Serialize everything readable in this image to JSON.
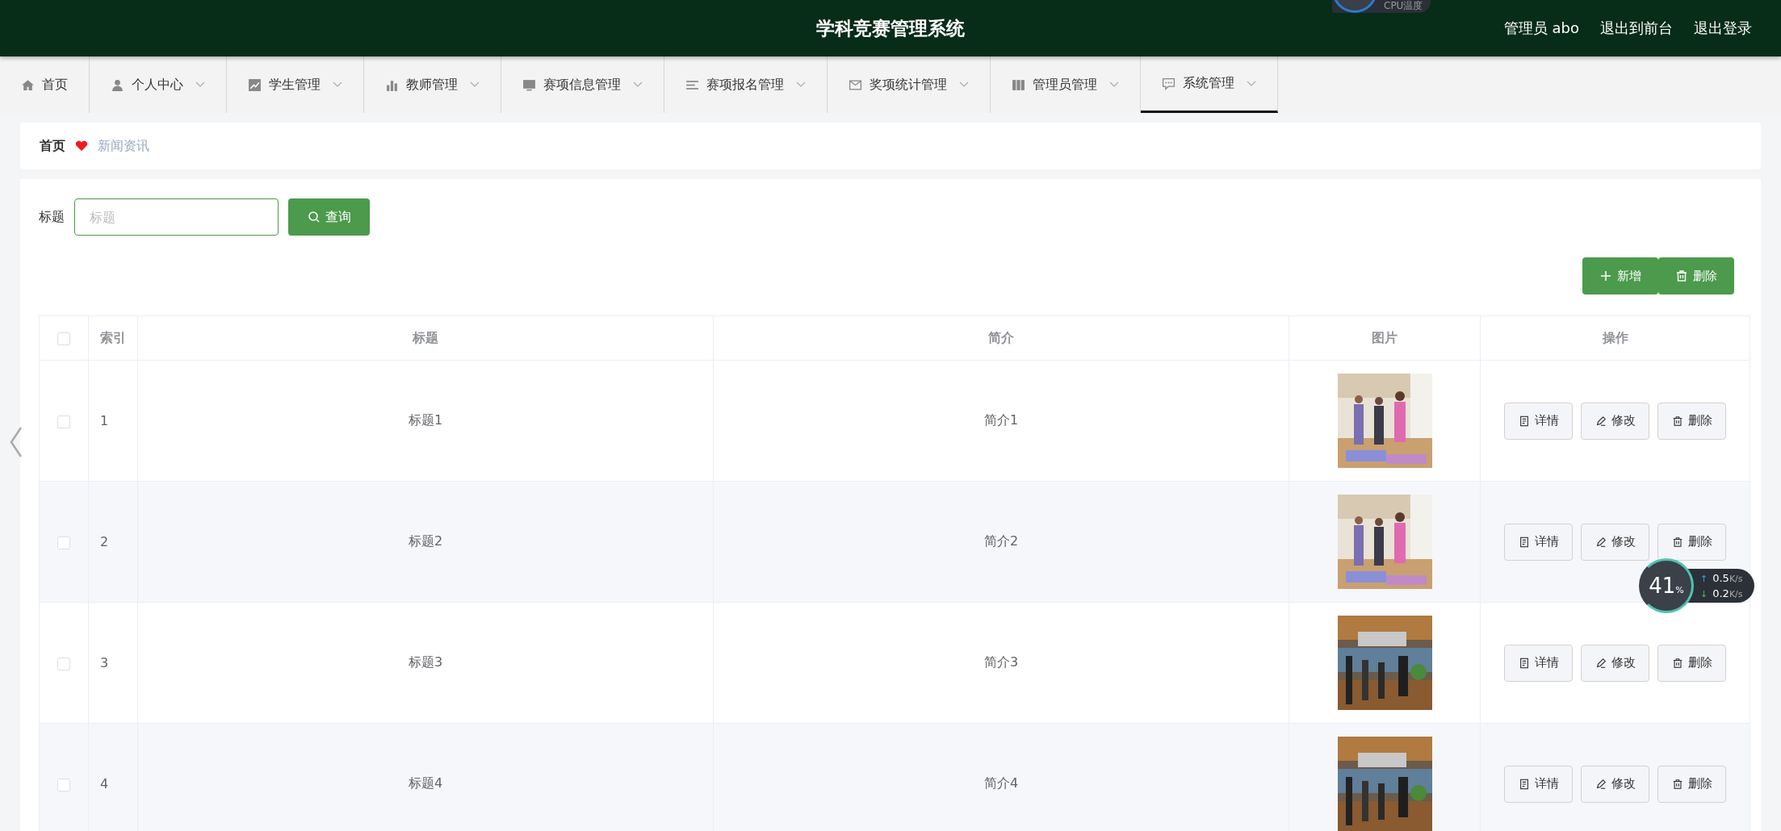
{
  "header": {
    "title": "学科竞赛管理系统",
    "user": "管理员 abo",
    "links": [
      "退出到前台",
      "退出登录"
    ]
  },
  "nav": [
    {
      "label": "首页",
      "dropdown": false,
      "selected": false
    },
    {
      "label": "个人中心",
      "dropdown": true,
      "selected": false
    },
    {
      "label": "学生管理",
      "dropdown": true,
      "selected": false
    },
    {
      "label": "教师管理",
      "dropdown": true,
      "selected": false
    },
    {
      "label": "赛项信息管理",
      "dropdown": true,
      "selected": false
    },
    {
      "label": "赛项报名管理",
      "dropdown": true,
      "selected": false
    },
    {
      "label": "奖项统计管理",
      "dropdown": true,
      "selected": false
    },
    {
      "label": "管理员管理",
      "dropdown": true,
      "selected": false
    },
    {
      "label": "系统管理",
      "dropdown": true,
      "selected": true
    }
  ],
  "breadcrumb": {
    "home": "首页",
    "current": "新闻资讯"
  },
  "search": {
    "label": "标题",
    "placeholder": "标题",
    "button": "查询"
  },
  "actions": [
    "新增",
    "删除"
  ],
  "table": {
    "select_all_checked": false,
    "columns": [
      "索引",
      "标题",
      "简介",
      "图片",
      "操作"
    ],
    "rows": [
      {
        "checked": false,
        "index": "1",
        "title": "标题1",
        "intro": "简介1",
        "picture": {
          "kind": "picture"
        },
        "actions": [
          "详情",
          "修改",
          "删除"
        ]
      },
      {
        "checked": false,
        "index": "2",
        "title": "标题2",
        "intro": "简介2",
        "picture": {
          "kind": "picture"
        },
        "actions": [
          "详情",
          "修改",
          "删除"
        ]
      },
      {
        "checked": false,
        "index": "3",
        "title": "标题3",
        "intro": "简介3",
        "picture": {
          "kind": "picture"
        },
        "actions": [
          "详情",
          "修改",
          "删除"
        ]
      },
      {
        "checked": false,
        "index": "4",
        "title": "标题4",
        "intro": "简介4",
        "picture": {
          "kind": "picture"
        },
        "actions": [
          "详情",
          "修改",
          "删除"
        ]
      }
    ]
  },
  "monitor": {
    "top_label": "CPU温度",
    "cpu": "41",
    "cpu_unit": "%",
    "upload_arrow": "↑",
    "upload": "0.5",
    "upload_unit": "K/s",
    "download_arrow": "↓",
    "download": "0.2",
    "download_unit": "K/s"
  }
}
